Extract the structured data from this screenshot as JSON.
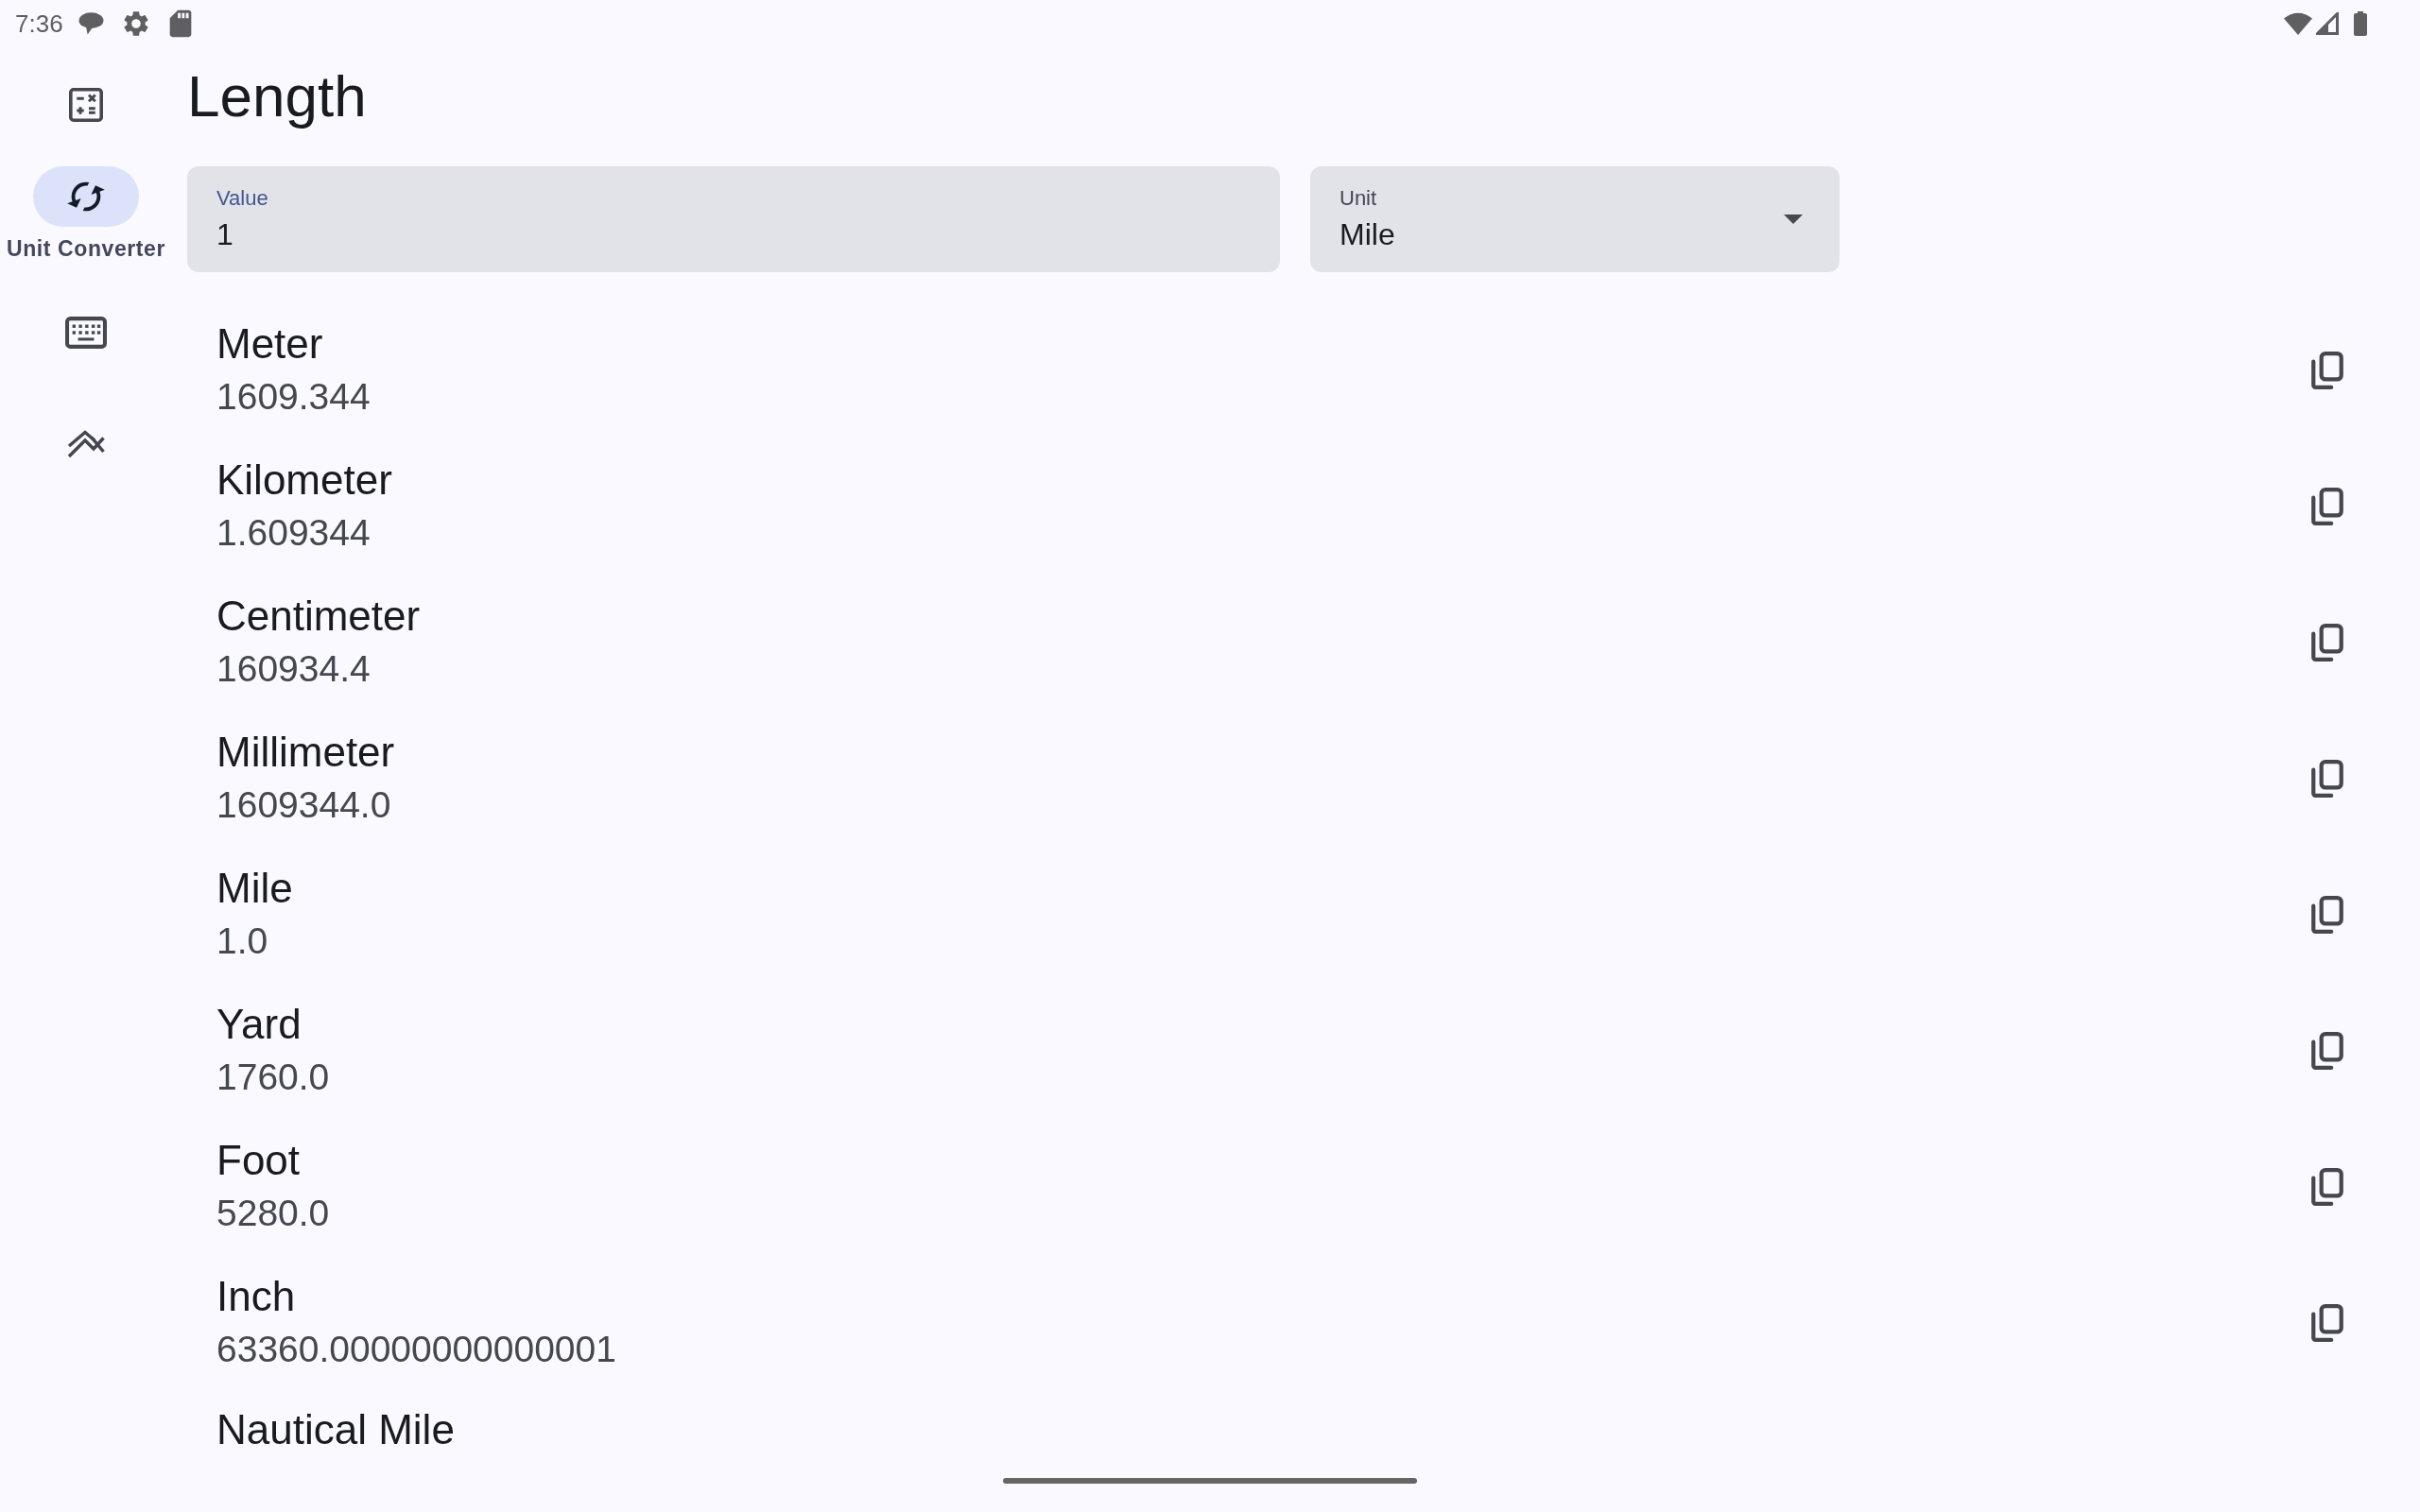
{
  "status_bar": {
    "time": "7:36"
  },
  "nav_rail": {
    "items": [
      {
        "selected": false
      },
      {
        "label": "Unit Converter",
        "selected": true
      },
      {
        "selected": false
      },
      {
        "selected": false
      }
    ]
  },
  "page": {
    "title": "Length"
  },
  "value_field": {
    "label": "Value",
    "value": "1",
    "focused": true
  },
  "unit_field": {
    "label": "Unit",
    "value": "Mile"
  },
  "results": [
    {
      "unit": "Meter",
      "value": "1609.344"
    },
    {
      "unit": "Kilometer",
      "value": "1.609344"
    },
    {
      "unit": "Centimeter",
      "value": "160934.4"
    },
    {
      "unit": "Millimeter",
      "value": "1609344.0"
    },
    {
      "unit": "Mile",
      "value": "1.0"
    },
    {
      "unit": "Yard",
      "value": "1760.0"
    },
    {
      "unit": "Foot",
      "value": "5280.0"
    },
    {
      "unit": "Inch",
      "value": "63360.00000000000001"
    },
    {
      "unit": "Nautical Mile"
    }
  ]
}
